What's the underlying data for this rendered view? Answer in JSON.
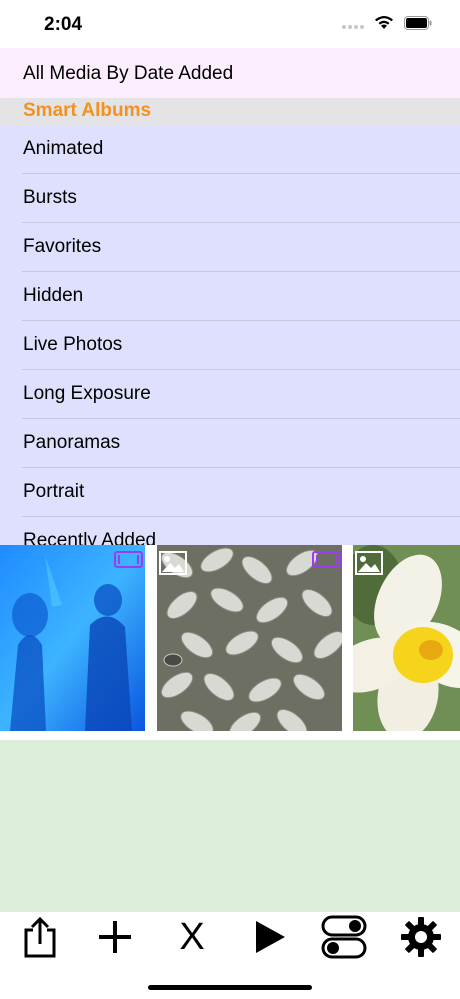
{
  "status_bar": {
    "time": "2:04"
  },
  "header": {
    "all_media_label": "All Media By Date Added"
  },
  "section": {
    "title": "Smart Albums"
  },
  "albums": [
    {
      "label": "Animated"
    },
    {
      "label": "Bursts"
    },
    {
      "label": "Favorites"
    },
    {
      "label": "Hidden"
    },
    {
      "label": "Live Photos"
    },
    {
      "label": "Long Exposure"
    },
    {
      "label": "Panoramas"
    },
    {
      "label": "Portrait"
    },
    {
      "label": "Recently Added"
    }
  ],
  "thumbnails": [
    {
      "subject": "blue-silhouettes",
      "badge": "video-icon"
    },
    {
      "subject": "leaf-pavement",
      "badge": "image-icon",
      "badge2": "video-icon"
    },
    {
      "subject": "yellow-flower",
      "badge": "image-icon"
    }
  ],
  "toolbar": {
    "items": [
      "share-icon",
      "add-icon",
      "close-x",
      "play-icon",
      "toggle-icon",
      "gear-icon"
    ],
    "close_label": "X"
  },
  "colors": {
    "all_media_bg": "#fdeefd",
    "section_bg": "#e4e4e6",
    "section_title": "#f5921f",
    "album_list_bg": "#dfe0fd",
    "green_area_bg": "#dcedd9",
    "badge_purple": "#9b3cf0"
  }
}
